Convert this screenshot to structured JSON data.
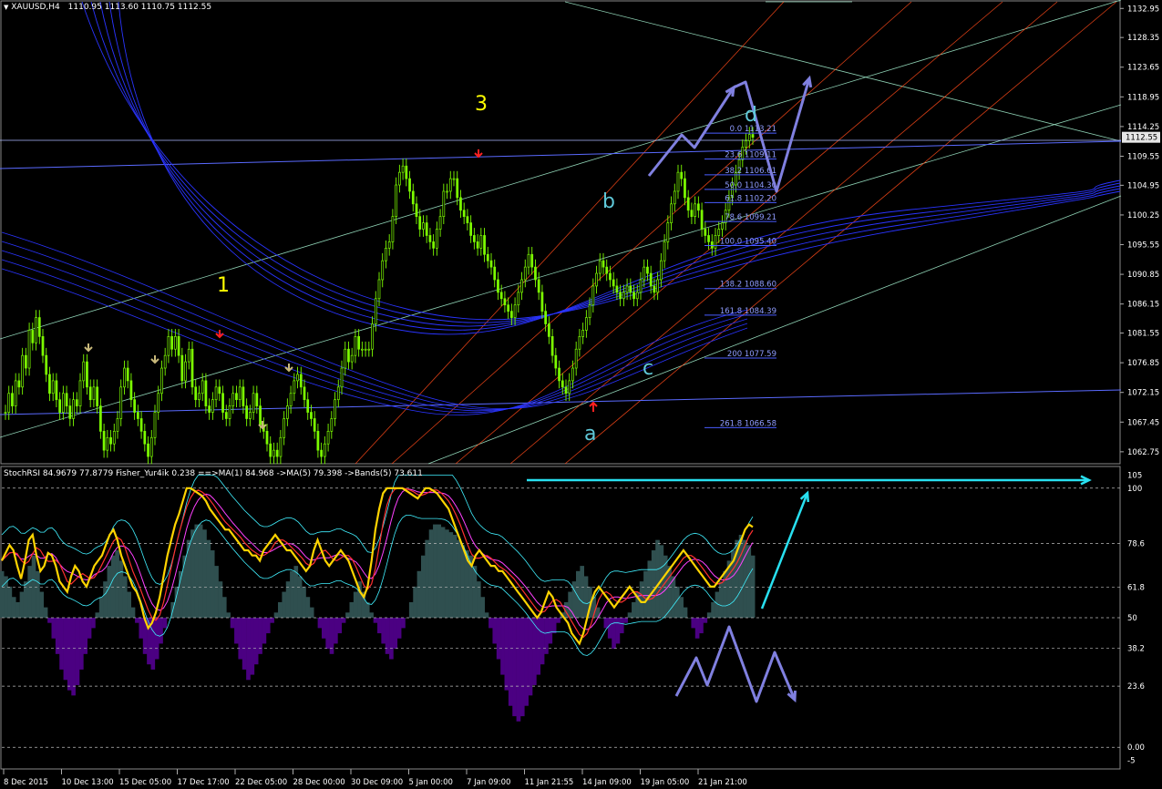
{
  "header": {
    "symbol": "XAUUSD,H4",
    "ohlc": "1110.95 1113.60 1110.75 1112.55",
    "indicator": "StochRSI 84.9679 77.8779  Fisher_Yur4ik 0.238  ==>MA(1) 84.968  ->MA(5) 79.398  ->Bands(5) 73.611"
  },
  "colors": {
    "background": "#000000",
    "candles": "#7cfc00",
    "price_label_bg": "#e6e6e6",
    "fib": "#4a5cff",
    "channel_red": "#ff4a1a",
    "channel_green": "#9ee8c8",
    "channel_blue": "#2a34ff",
    "stoch_yellow": "#ffd400",
    "stoch_red": "#ff3030",
    "stoch_magenta": "#ff40ff",
    "band_cyan": "#40f0ff",
    "hist_pos": "#2f4f4f",
    "hist_neg": "#4b0082",
    "arrow_violet": "#8080e0",
    "arrow_cyan": "#28e0f0",
    "wave_yellow": "#ffff00",
    "wave_cyan": "#5fc8d8"
  },
  "chart_data": [
    {
      "type": "candlestick",
      "title": "XAUUSD,H4",
      "ylim": [
        1061.0,
        1134.0
      ],
      "y_ticks": [
        "1132.95",
        "1128.35",
        "1123.65",
        "1118.95",
        "1114.25",
        "1109.55",
        "1104.95",
        "1100.25",
        "1095.55",
        "1090.85",
        "1086.15",
        "1081.55",
        "1076.85",
        "1072.15",
        "1067.45",
        "1062.75"
      ],
      "current_price": "1112.55",
      "price_series": [
        1069,
        1072,
        1070,
        1074,
        1073,
        1078,
        1076,
        1082,
        1080,
        1084,
        1081,
        1078,
        1075,
        1072,
        1074,
        1071,
        1069,
        1072,
        1070,
        1068,
        1071,
        1070,
        1074,
        1077,
        1073,
        1071,
        1073,
        1070,
        1066,
        1063,
        1065,
        1064,
        1066,
        1068,
        1073,
        1076,
        1074,
        1071,
        1069,
        1068,
        1066,
        1064,
        1062,
        1065,
        1069,
        1072,
        1076,
        1078,
        1081,
        1079,
        1081,
        1078,
        1074,
        1077,
        1079,
        1073,
        1071,
        1072,
        1074,
        1070,
        1069,
        1071,
        1073,
        1072,
        1069,
        1068,
        1070,
        1072,
        1071,
        1073,
        1070,
        1068,
        1069,
        1072,
        1070,
        1067,
        1066,
        1064,
        1062,
        1063,
        1062,
        1065,
        1068,
        1070,
        1072,
        1074,
        1075,
        1073,
        1071,
        1069,
        1068,
        1066,
        1063,
        1062,
        1064,
        1066,
        1068,
        1071,
        1073,
        1076,
        1079,
        1077,
        1078,
        1081,
        1079,
        1079,
        1079,
        1079,
        1083,
        1087,
        1090,
        1093,
        1095,
        1096,
        1100,
        1105,
        1107,
        1108,
        1106,
        1104,
        1102,
        1100,
        1098,
        1099,
        1097,
        1096,
        1095,
        1098,
        1100,
        1104,
        1104,
        1106,
        1106,
        1103,
        1101,
        1100,
        1099,
        1097,
        1096,
        1095,
        1097,
        1094,
        1093,
        1092,
        1090,
        1088,
        1087,
        1086,
        1085,
        1084,
        1086,
        1088,
        1090,
        1092,
        1094,
        1092,
        1090,
        1088,
        1085,
        1083,
        1081,
        1078,
        1076,
        1074,
        1073,
        1072,
        1074,
        1076,
        1079,
        1081,
        1082,
        1084,
        1086,
        1089,
        1091,
        1093,
        1092,
        1091,
        1090,
        1089,
        1088,
        1087,
        1088,
        1089,
        1088,
        1087,
        1088,
        1090,
        1092,
        1091,
        1089,
        1088,
        1090,
        1093,
        1096,
        1099,
        1102,
        1104,
        1107,
        1106,
        1103,
        1101,
        1100,
        1102,
        1101,
        1098,
        1097,
        1096,
        1095,
        1097,
        1098,
        1099,
        1101,
        1103,
        1105,
        1107,
        1109,
        1111,
        1112,
        1113,
        1112.55
      ],
      "wave_labels": [
        "1",
        "3",
        "a",
        "b",
        "c",
        "d"
      ],
      "fibonacci": [
        {
          "level": "0.0",
          "price": "1113.21",
          "label": "0.0 1113.21"
        },
        {
          "level": "23.6",
          "price": "1109.11",
          "label": "23.6 1109.11"
        },
        {
          "level": "38.2",
          "price": "1106.61",
          "label": "38.2 1106.61"
        },
        {
          "level": "50.0",
          "price": "1104.30",
          "label": "50.0 1104.30"
        },
        {
          "level": "61.8",
          "price": "1102.20",
          "label": "61.8 1102.20"
        },
        {
          "level": "78.6",
          "price": "1099.21",
          "label": "78.6 1099.21"
        },
        {
          "level": "100.0",
          "price": "1095.40",
          "label": "100.0 1095.40"
        },
        {
          "level": "138.2",
          "price": "1088.60",
          "label": "138.2 1088.60"
        },
        {
          "level": "161.8",
          "price": "1084.39",
          "label": "161.8 1084.39"
        },
        {
          "level": "200",
          "price": "1077.59",
          "label": "200 1077.59"
        },
        {
          "level": "261.8",
          "price": "1066.58",
          "label": "261.8 1066.58"
        }
      ]
    },
    {
      "type": "line",
      "title": "StochRSI 84.9679 77.8779",
      "ylim": [
        -8,
        108
      ],
      "y_ticks": [
        "105",
        "100",
        "78.6",
        "61.8",
        "50",
        "38.2",
        "23.6",
        "0.00",
        "-5"
      ],
      "stoch_series": [
        72,
        75,
        78,
        76,
        70,
        65,
        72,
        80,
        82,
        74,
        68,
        70,
        75,
        74,
        70,
        64,
        62,
        60,
        66,
        70,
        68,
        64,
        62,
        66,
        70,
        72,
        74,
        78,
        82,
        84,
        80,
        74,
        70,
        66,
        62,
        60,
        56,
        50,
        46,
        48,
        52,
        58,
        66,
        74,
        80,
        86,
        90,
        95,
        100,
        100,
        99,
        98,
        97,
        95,
        92,
        90,
        88,
        86,
        84,
        84,
        82,
        80,
        78,
        76,
        76,
        74,
        74,
        72,
        76,
        78,
        80,
        82,
        80,
        78,
        76,
        76,
        74,
        72,
        70,
        68,
        70,
        76,
        80,
        76,
        72,
        70,
        72,
        74,
        76,
        74,
        72,
        68,
        64,
        60,
        58,
        62,
        72,
        84,
        92,
        98,
        100,
        100,
        100,
        100,
        100,
        99,
        98,
        97,
        96,
        98,
        100,
        100,
        99,
        98,
        96,
        94,
        92,
        88,
        84,
        80,
        76,
        72,
        70,
        74,
        76,
        74,
        72,
        70,
        70,
        68,
        68,
        66,
        64,
        62,
        60,
        58,
        56,
        54,
        52,
        50,
        52,
        56,
        60,
        58,
        54,
        52,
        50,
        48,
        44,
        42,
        40,
        44,
        50,
        56,
        60,
        62,
        60,
        58,
        56,
        54,
        56,
        58,
        60,
        62,
        60,
        58,
        56,
        56,
        58,
        60,
        62,
        64,
        66,
        68,
        70,
        72,
        74,
        76,
        74,
        72,
        70,
        68,
        66,
        64,
        62,
        62,
        64,
        66,
        68,
        70,
        72,
        76,
        80,
        84,
        86,
        85
      ],
      "fisher_hist": [
        18,
        16,
        12,
        8,
        6,
        10,
        14,
        20,
        24,
        18,
        10,
        4,
        -2,
        -8,
        -14,
        -20,
        -24,
        -28,
        -30,
        -26,
        -20,
        -14,
        -8,
        -4,
        2,
        8,
        14,
        20,
        24,
        26,
        22,
        16,
        10,
        4,
        -2,
        -8,
        -14,
        -18,
        -20,
        -16,
        -10,
        -4,
        0,
        6,
        12,
        18,
        24,
        30,
        34,
        36,
        36,
        34,
        30,
        26,
        20,
        14,
        8,
        2,
        -4,
        -10,
        -16,
        -20,
        -24,
        -22,
        -18,
        -14,
        -10,
        -6,
        -2,
        2,
        6,
        10,
        14,
        18,
        20,
        16,
        12,
        8,
        4,
        0,
        -4,
        -8,
        -12,
        -14,
        -10,
        -6,
        -2,
        2,
        6,
        10,
        14,
        10,
        6,
        2,
        -2,
        -6,
        -10,
        -14,
        -16,
        -12,
        -8,
        -4,
        0,
        6,
        12,
        18,
        24,
        30,
        34,
        36,
        36,
        35,
        34,
        33,
        32,
        30,
        28,
        26,
        24,
        20,
        14,
        8,
        2,
        -4,
        -10,
        -16,
        -22,
        -28,
        -34,
        -38,
        -40,
        -38,
        -34,
        -30,
        -26,
        -22,
        -18,
        -14,
        -10,
        -6,
        -2,
        2,
        6,
        10,
        14,
        18,
        20,
        16,
        12,
        8,
        4,
        0,
        -4,
        -8,
        -12,
        -10,
        -6,
        -2,
        2,
        6,
        10,
        14,
        18,
        22,
        26,
        30,
        28,
        24,
        20,
        16,
        12,
        8,
        4,
        0,
        -4,
        -8,
        -6,
        -2,
        2,
        6,
        10,
        14,
        18,
        22,
        26,
        30,
        32,
        30,
        28,
        24
      ]
    }
  ],
  "x_axis": {
    "labels": [
      "8 Dec 2015",
      "10 Dec 13:00",
      "15 Dec 05:00",
      "17 Dec 17:00",
      "22 Dec 05:00",
      "28 Dec 00:00",
      "30 Dec 09:00",
      "5 Jan 00:00",
      "7 Jan 09:00",
      "11 Jan 21:55",
      "14 Jan 09:00",
      "19 Jan 05:00",
      "21 Jan 21:00"
    ]
  }
}
